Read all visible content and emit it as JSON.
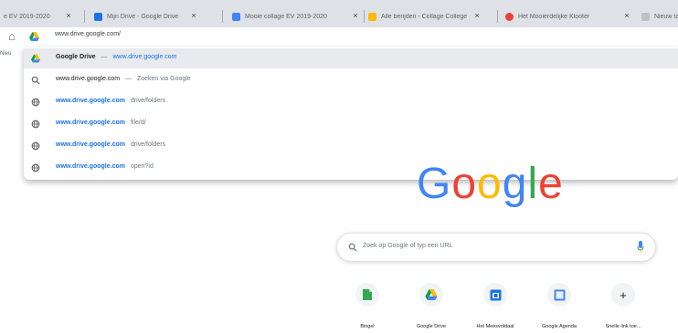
{
  "tabs": [
    {
      "title": "e EV 2019-2020",
      "favicon_color": "#9aa0a6"
    },
    {
      "title": "Mijn Drive - Google Drive",
      "favicon_color": "#1a73e8"
    },
    {
      "title": "Mooie collage EV 2019-2020",
      "favicon_color": "#4285f4"
    },
    {
      "title": "Alle berijden - Collage College",
      "favicon_color": "#fbbc05"
    },
    {
      "title": "Het Mooierdelijke Klooter",
      "favicon_color": "#ea4335"
    },
    {
      "title": "Nieuw tabblad",
      "favicon_color": "#bdc1c6"
    }
  ],
  "tab_close_glyph": "×",
  "toolbar": {
    "address_text": "www.drive.google.com/"
  },
  "left_edge_text": "Nieu",
  "suggestions": [
    {
      "icon": "drive",
      "title": "Google Drive",
      "url": "www.drive.google.com",
      "selected": true
    },
    {
      "icon": "search",
      "title": "www.drive.google.com",
      "suffix": "Zoeken via Google"
    },
    {
      "icon": "history",
      "title": "www.drive.google.com",
      "suffix": "drive/folders"
    },
    {
      "icon": "history",
      "title": "www.drive.google.com",
      "suffix": "file/d/"
    },
    {
      "icon": "history",
      "title": "www.drive.google.com",
      "suffix": "drive/folders"
    },
    {
      "icon": "history",
      "title": "www.drive.google.com",
      "suffix": "open?id"
    }
  ],
  "separator": "—",
  "logo": {
    "letters": [
      "G",
      "o",
      "o",
      "g",
      "l",
      "e"
    ]
  },
  "search": {
    "placeholder": "Zoek op Google of typ een URL"
  },
  "shortcuts": [
    {
      "label": "Bingel",
      "icon": "bingel",
      "color": "#34a853"
    },
    {
      "label": "Google Drive",
      "icon": "drive",
      "color": "#1a73e8"
    },
    {
      "label": "Het Meesvoldaal",
      "icon": "calendar",
      "color": "#1a73e8"
    },
    {
      "label": "Google Agenda",
      "icon": "agenda",
      "color": "#4285f4"
    },
    {
      "label": "Snelle link toe...",
      "icon": "add",
      "color": "#5f6368"
    }
  ],
  "colors": {
    "tabstrip": "#dee1e6",
    "selected_row": "#e8eaed",
    "link_blue": "#1a73e8"
  }
}
